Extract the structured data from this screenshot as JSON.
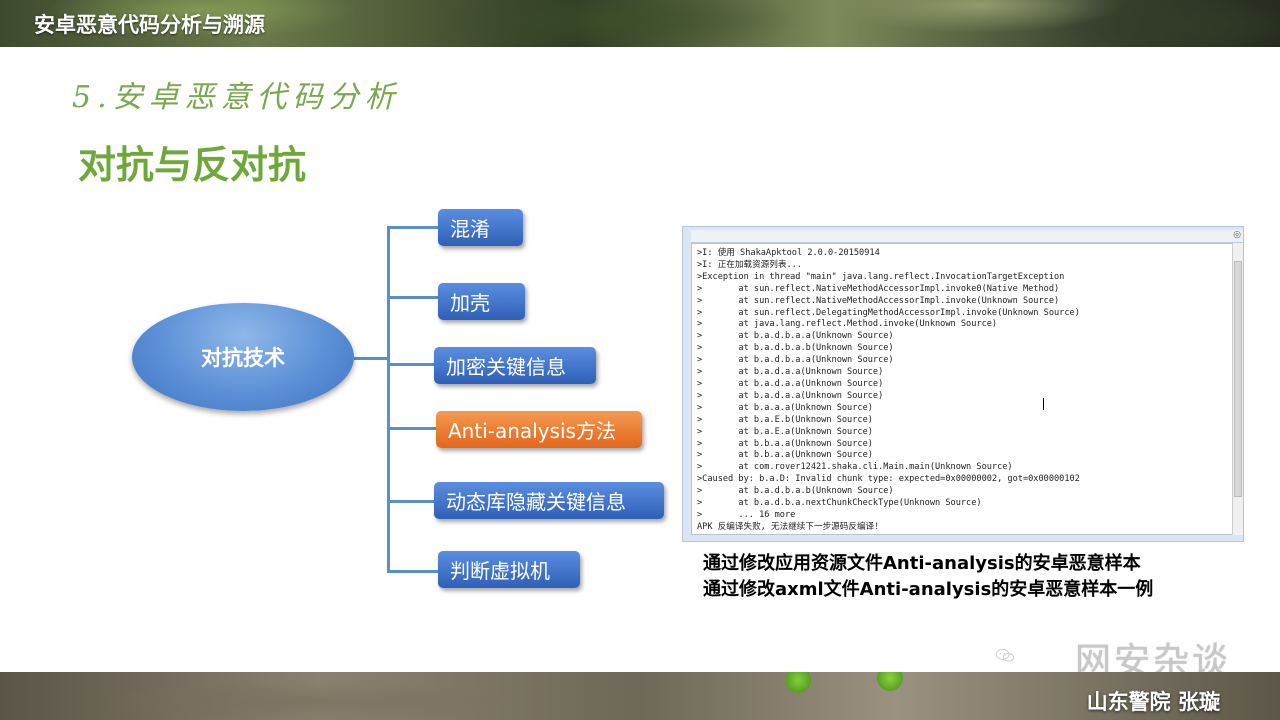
{
  "header": {
    "title": "安卓恶意代码分析与溯源"
  },
  "section_title": "5.安卓恶意代码分析",
  "main_title": "对抗与反对抗",
  "mindmap": {
    "center": "对抗技术",
    "nodes": [
      "混淆",
      "加壳",
      "加密关键信息",
      "Anti-analysis方法",
      "动态库隐藏关键信息",
      "判断虚拟机"
    ],
    "highlighted": "Anti-analysis方法",
    "colors": {
      "node": "#3a6cc6",
      "highlight": "#e86f24",
      "connector": "#5b8fc9"
    }
  },
  "console": {
    "lines": [
      ">I: 使用 ShakaApktool 2.0.0-20150914",
      ">I: 正在加载资源列表...",
      ">Exception in thread \"main\" java.lang.reflect.InvocationTargetException",
      ">       at sun.reflect.NativeMethodAccessorImpl.invoke0(Native Method)",
      ">       at sun.reflect.NativeMethodAccessorImpl.invoke(Unknown Source)",
      ">       at sun.reflect.DelegatingMethodAccessorImpl.invoke(Unknown Source)",
      ">       at java.lang.reflect.Method.invoke(Unknown Source)",
      ">       at b.a.d.b.a.a(Unknown Source)",
      ">       at b.a.d.b.a.b(Unknown Source)",
      ">       at b.a.d.b.a.a(Unknown Source)",
      ">       at b.a.d.a.a(Unknown Source)",
      ">       at b.a.d.a.a(Unknown Source)",
      ">       at b.a.d.a.a(Unknown Source)",
      ">       at b.a.a.a(Unknown Source)",
      ">       at b.a.E.b(Unknown Source)",
      ">       at b.a.E.a(Unknown Source)",
      ">       at b.b.a.a(Unknown Source)",
      ">       at b.b.a.a(Unknown Source)",
      ">       at com.rover12421.shaka.cli.Main.main(Unknown Source)",
      ">Caused by: b.a.D: Invalid chunk type: expected=0x00000002, got=0x00000102",
      ">       at b.a.d.b.a.b(Unknown Source)",
      ">       at b.a.d.b.a.nextChunkCheckType(Unknown Source)",
      ">       ... 16 more",
      "APK 反编译失败, 无法继续下一步源码反编译!"
    ]
  },
  "captions": [
    "通过修改应用资源文件Anti-analysis的安卓恶意样本",
    "通过修改axml文件Anti-analysis的安卓恶意样本一例"
  ],
  "watermark": {
    "text": "网安杂谈",
    "icon": "wechat-icon"
  },
  "footer": {
    "author": "山东警院  张璇"
  }
}
